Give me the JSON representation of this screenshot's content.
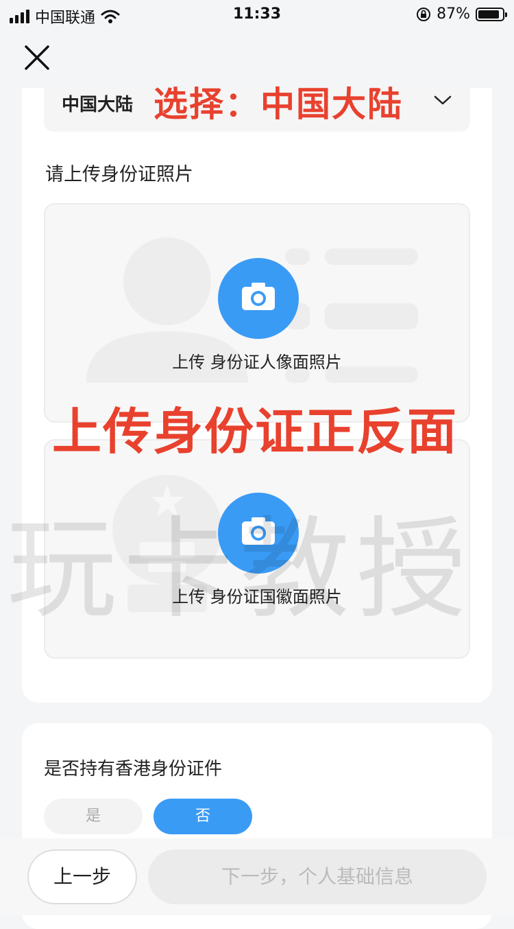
{
  "status_bar": {
    "carrier": "中国联通",
    "time": "11:33",
    "battery": "87%",
    "battery_level": 0.87
  },
  "region": {
    "label": "中国大陆",
    "overlay": "选择：中国大陆"
  },
  "upload": {
    "title": "请上传身份证照片",
    "front_label": "上传 身份证人像面照片",
    "back_label": "上传 身份证国徽面照片"
  },
  "overlay_text": "上传身份证正反面",
  "watermark": "玩卡教授",
  "hk_id": {
    "question": "是否持有香港身份证件",
    "yes": "是",
    "no": "否"
  },
  "footer": {
    "prev": "上一步",
    "next": "下一步，个人基础信息"
  },
  "colors": {
    "accent": "#3a9bf5",
    "overlay_red": "#e8412e",
    "background": "#f4f5f7"
  }
}
